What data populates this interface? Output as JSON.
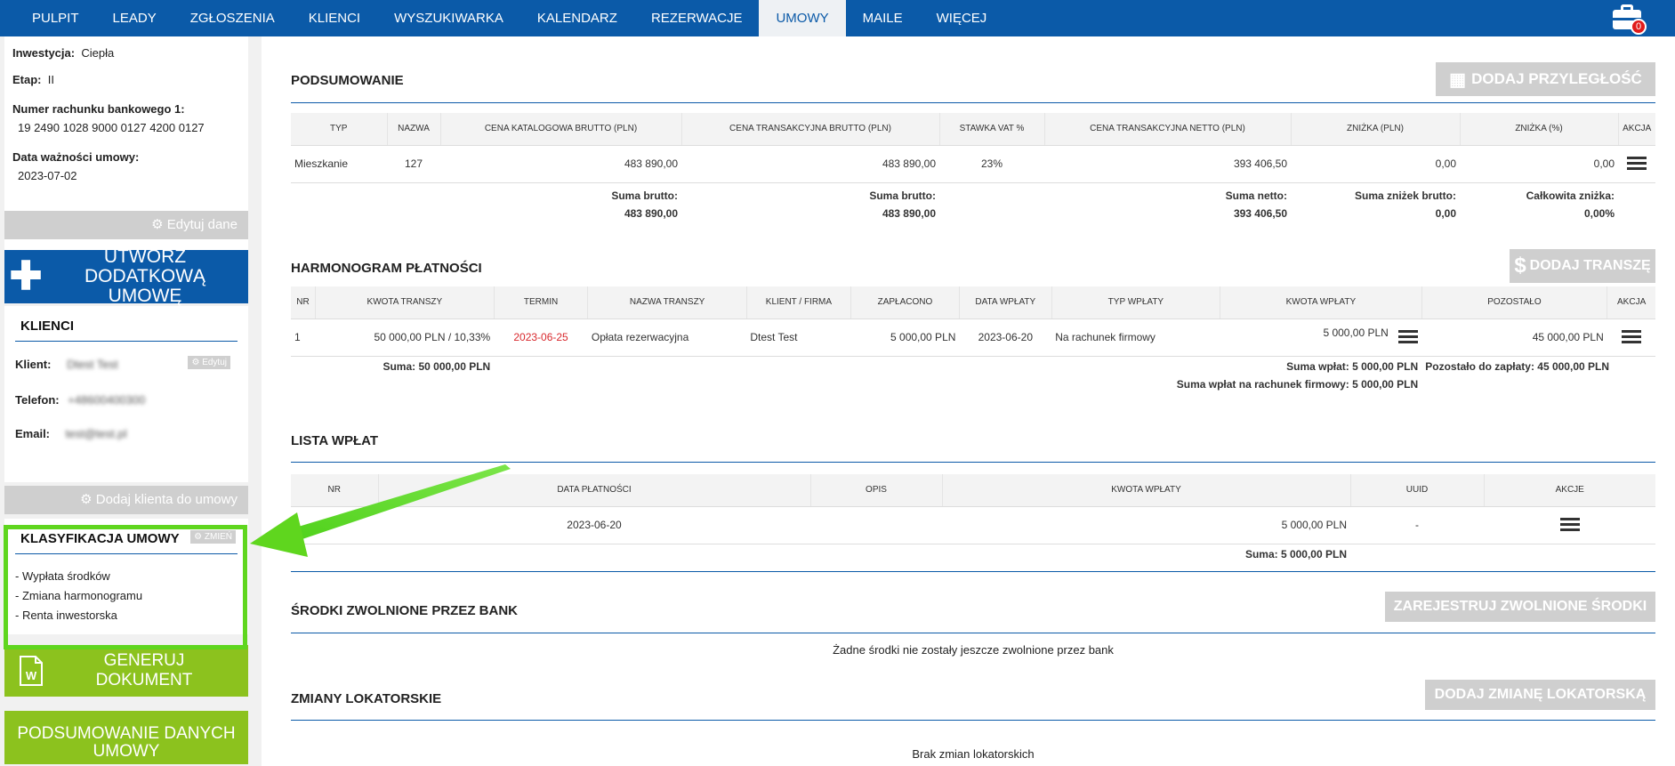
{
  "nav": {
    "items": [
      "PULPIT",
      "LEADY",
      "ZGŁOSZENIA",
      "KLIENCI",
      "WYSZUKIWARKA",
      "KALENDARZ",
      "REZERWACJE",
      "UMOWY",
      "MAILE",
      "WIĘCEJ"
    ],
    "active": "UMOWY",
    "badge": "0"
  },
  "sidebar": {
    "inwestycja_label": "Inwestycja:",
    "inwestycja_value": "Ciepła",
    "etap_label": "Etap:",
    "etap_value": "II",
    "konto_label": "Numer rachunku bankowego 1:",
    "konto_value": "19 2490 1028 9000 0127 4200 0127",
    "waznosc_label": "Data ważności umowy:",
    "waznosc_value": "2023-07-02",
    "edit_button": "Edytuj dane",
    "create_button": "UTWÓRZ DODATKOWĄ UMOWĘ",
    "klienci_title": "KLIENCI",
    "klient_label": "Klient:",
    "klient_value": "Dtest Test",
    "klient_edit": "Edytuj",
    "telefon_label": "Telefon:",
    "telefon_value": "+48600400300",
    "email_label": "Email:",
    "email_value": "test@test.pl",
    "add_client_button": "Dodaj klienta do umowy",
    "klasyfikacja_title": "KLASYFIKACJA UMOWY",
    "zmien_button": "ZMIEŃ",
    "klasyfikacja_items": [
      "- Wypłata środków",
      "- Zmiana harmonogramu",
      "- Renta inwestorska"
    ],
    "generuj_button": "GENERUJ DOKUMENT",
    "podsumowanie_button": "PODSUMOWANIE DANYCH UMOWY"
  },
  "podsumowanie": {
    "title": "PODSUMOWANIE",
    "button": "DODAJ PRZYLEGŁOŚĆ",
    "headers": [
      "TYP",
      "NAZWA",
      "CENA KATALOGOWA BRUTTO (PLN)",
      "CENA TRANSAKCYJNA BRUTTO (PLN)",
      "STAWKA VAT %",
      "CENA TRANSAKCYJNA NETTO (PLN)",
      "ZNIŻKA (PLN)",
      "ZNIŻKA (%)",
      "AKCJA"
    ],
    "row": [
      "Mieszkanie",
      "127",
      "483 890,00",
      "483 890,00",
      "23%",
      "393 406,50",
      "0,00",
      "0,00"
    ],
    "sums": {
      "kat_label": "Suma brutto:",
      "kat_value": "483 890,00",
      "trans_label": "Suma brutto:",
      "trans_value": "483 890,00",
      "netto_label": "Suma netto:",
      "netto_value": "393 406,50",
      "znizek_label": "Suma zniżek brutto:",
      "znizek_value": "0,00",
      "calk_label": "Całkowita zniżka:",
      "calk_value": "0,00%"
    }
  },
  "harmonogram": {
    "title": "HARMONOGRAM PŁATNOŚCI",
    "button": "DODAJ TRANSZĘ",
    "headers": [
      "NR",
      "KWOTA TRANSZY",
      "TERMIN",
      "NAZWA TRANSZY",
      "KLIENT / FIRMA",
      "ZAPŁACONO",
      "DATA WPŁATY",
      "TYP WPŁATY",
      "KWOTA WPŁATY",
      "POZOSTAŁO",
      "AKCJA"
    ],
    "row": [
      "1",
      "50 000,00 PLN / 10,33%",
      "2023-06-25",
      "Opłata rezerwacyjna",
      "Dtest Test",
      "5 000,00 PLN",
      "2023-06-20",
      "Na rachunek firmowy",
      "5 000,00 PLN",
      "45 000,00 PLN"
    ],
    "suma": "Suma: 50 000,00 PLN",
    "suma_wplat": "Suma wpłat: 5 000,00 PLN",
    "suma_wplat_firmowy": "Suma wpłat na rachunek firmowy: 5 000,00 PLN",
    "pozostalo": "Pozostało do zapłaty: 45 000,00 PLN"
  },
  "wplaty": {
    "title": "LISTA WPŁAT",
    "headers": [
      "NR",
      "DATA PŁATNOŚCI",
      "OPIS",
      "KWOTA WPŁATY",
      "UUID",
      "AKCJE"
    ],
    "row": [
      "",
      "2023-06-20",
      "",
      "5 000,00 PLN",
      "-"
    ],
    "suma": "Suma: 5 000,00 PLN"
  },
  "srodki": {
    "title": "ŚRODKI ZWOLNIONE PRZEZ BANK",
    "button": "ZAREJESTRUJ ZWOLNIONE ŚRODKI",
    "empty": "Żadne środki nie zostały jeszcze zwolnione przez bank"
  },
  "zmiany": {
    "title": "ZMIANY LOKATORSKIE",
    "button": "DODAJ ZMIANĘ LOKATORSKĄ",
    "empty": "Brak zmian lokatorskich"
  },
  "colors": {
    "nav": "#0b5aa8",
    "highlight": "#5fd61e",
    "green_button": "#8cc21e",
    "gray_button": "#cfcfcf",
    "red": "#d8282d"
  }
}
